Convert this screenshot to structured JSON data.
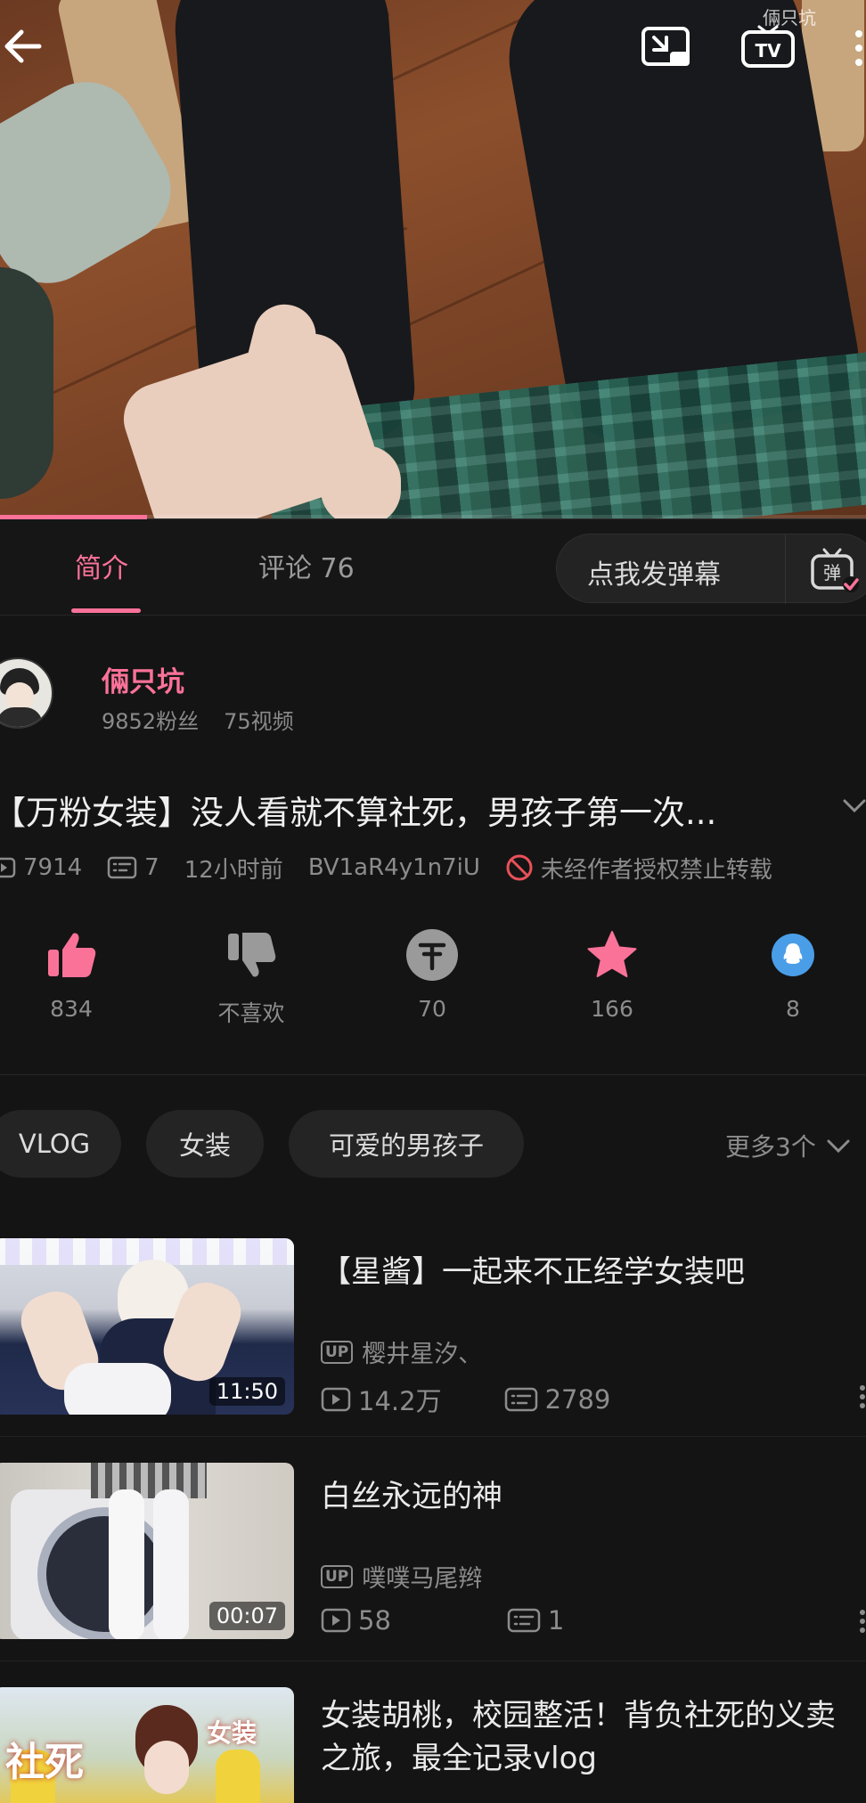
{
  "video": {
    "watermark": "倆只坑",
    "progress_percent": 17
  },
  "tabs": {
    "intro": "简介",
    "comments": "评论 76",
    "danmaku_placeholder": "点我发弹幕",
    "danmaku_icon_label": "弹"
  },
  "uploader": {
    "name": "倆只坑",
    "followers": "9852粉丝",
    "videos": "75视频"
  },
  "info": {
    "title": "【万粉女装】没人看就不算社死，男孩子第一次...",
    "plays": "7914",
    "danmaku_count": "7",
    "time": "12小时前",
    "bvid": "BV1aR4y1n7iU",
    "notice": "未经作者授权禁止转载"
  },
  "actions": {
    "like": "834",
    "dislike": "不喜欢",
    "coin": "70",
    "favorite": "166",
    "share": "8"
  },
  "tags": {
    "items": [
      "VLOG",
      "女装",
      "可爱的男孩子"
    ],
    "more": "更多3个"
  },
  "related": [
    {
      "title": "【星酱】一起来不正经学女装吧",
      "author": "樱井星汐、",
      "views": "14.2万",
      "danmaku": "2789",
      "duration": "11:50"
    },
    {
      "title": "白丝永远的神",
      "author": "噗噗马尾辫",
      "views": "58",
      "danmaku": "1",
      "duration": "00:07"
    },
    {
      "title": "女装胡桃，校园整活！背负社死的义卖之旅，最全记录vlog",
      "thumb_text_1": "社死",
      "thumb_text_2": "女装"
    }
  ],
  "up_badge": "UP",
  "colors": {
    "accent": "#fb7299",
    "background": "#141414",
    "share_blue": "#4a9ee8"
  }
}
